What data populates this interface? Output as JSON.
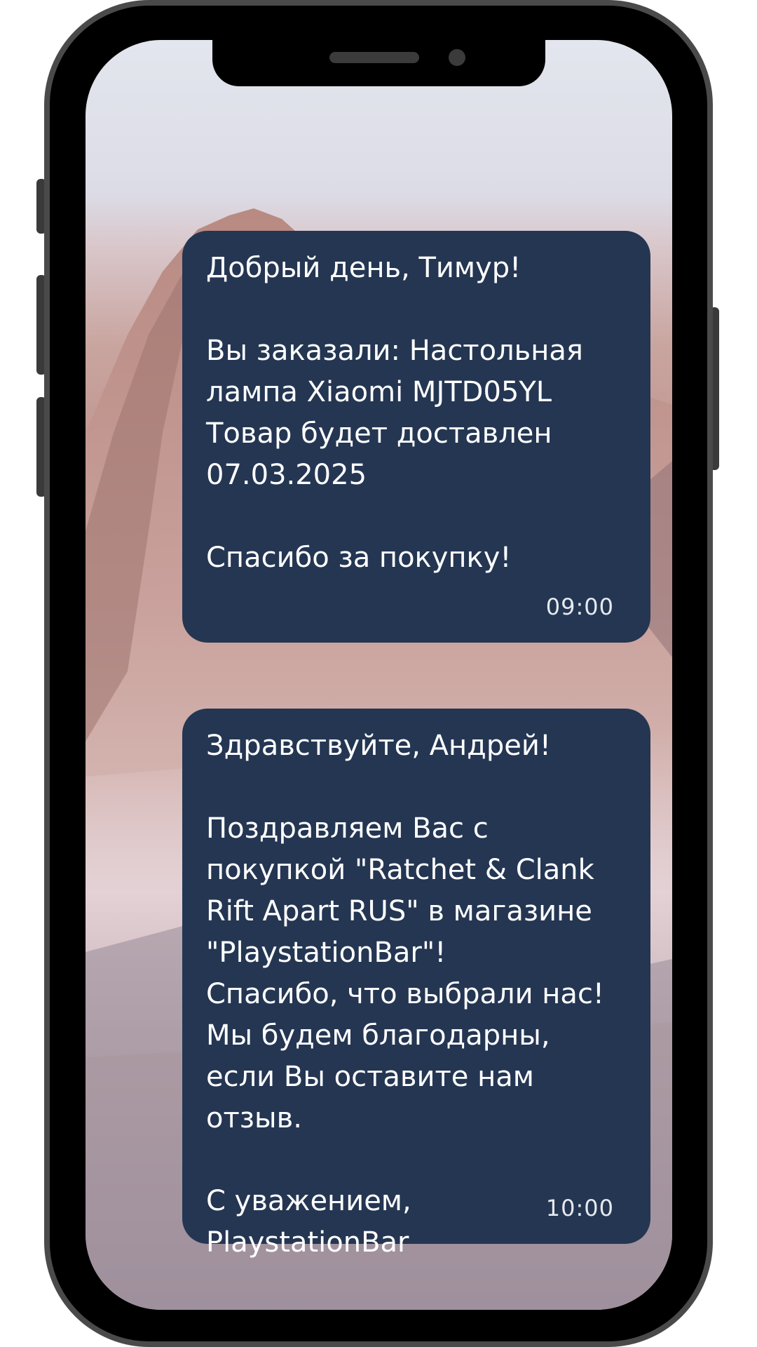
{
  "messages": [
    {
      "text": "Добрый день, Тимур!\n\nВы заказали: Настольная лампа Xiaomi  MJTD05YL\nТовар будет доставлен 07.03.2025\n\nСпасибо за покупку!",
      "time": "09:00"
    },
    {
      "text": "Здравствуйте, Андрей!\n\nПоздравляем Вас с покупкой \"Ratchet & Clank Rift Apart RUS\" в магазине \"PlaystationBar\"!\nСпасибо, что выбрали нас!\nМы будем благодарны, если Вы оставите нам отзыв.\n\nС уважением, PlaystationBar",
      "time": "10:00"
    }
  ],
  "colors": {
    "bubble_background": "#243652",
    "bubble_text": "#ffffff",
    "phone_frame": "#4a4a4a"
  }
}
